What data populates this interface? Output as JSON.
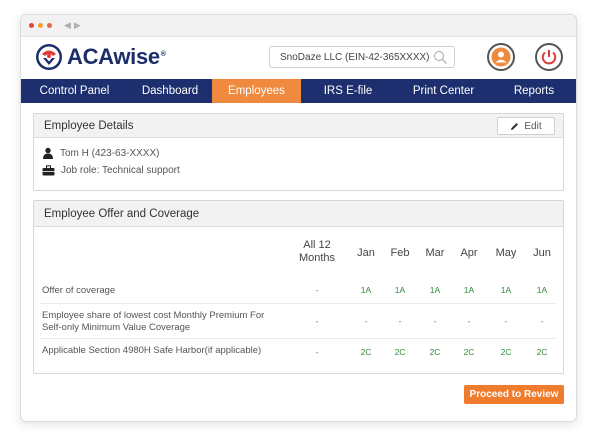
{
  "app": {
    "brand": "ACAwise",
    "reg_mark": "®",
    "company_selector": "SnoDaze LLC (EIN-42-365XXXX)"
  },
  "nav": {
    "items": [
      {
        "label": "Control Panel"
      },
      {
        "label": "Dashboard"
      },
      {
        "label": "Employees"
      },
      {
        "label": "IRS E-file"
      },
      {
        "label": "Print Center"
      },
      {
        "label": "Reports"
      }
    ],
    "active": "Employees"
  },
  "employee_details": {
    "title": "Employee Details",
    "edit_label": "Edit",
    "name": "Tom H (423-63-XXXX)",
    "job_role": "Job role: Technical support"
  },
  "coverage": {
    "title": "Employee Offer and Coverage",
    "columns": [
      "All 12 Months",
      "Jan",
      "Feb",
      "Mar",
      "Apr",
      "May",
      "Jun"
    ],
    "rows": [
      {
        "label": "Offer of coverage",
        "values": [
          "-",
          "1A",
          "1A",
          "1A",
          "1A",
          "1A",
          "1A"
        ]
      },
      {
        "label": "Employee share of lowest cost Monthly Premium For Self-only Minimum Value Coverage",
        "values": [
          "-",
          "-",
          "-",
          "-",
          "-",
          "-",
          "-"
        ]
      },
      {
        "label": "Applicable Section 4980H Safe Harbor(if applicable)",
        "values": [
          "-",
          "2C",
          "2C",
          "2C",
          "2C",
          "2C",
          "2C"
        ]
      }
    ]
  },
  "actions": {
    "proceed_label": "Proceed to Review"
  },
  "colors": {
    "brand_navy": "#1d2f6f",
    "accent_orange": "#ef8a3f",
    "code_green": "#2e8b3a"
  }
}
